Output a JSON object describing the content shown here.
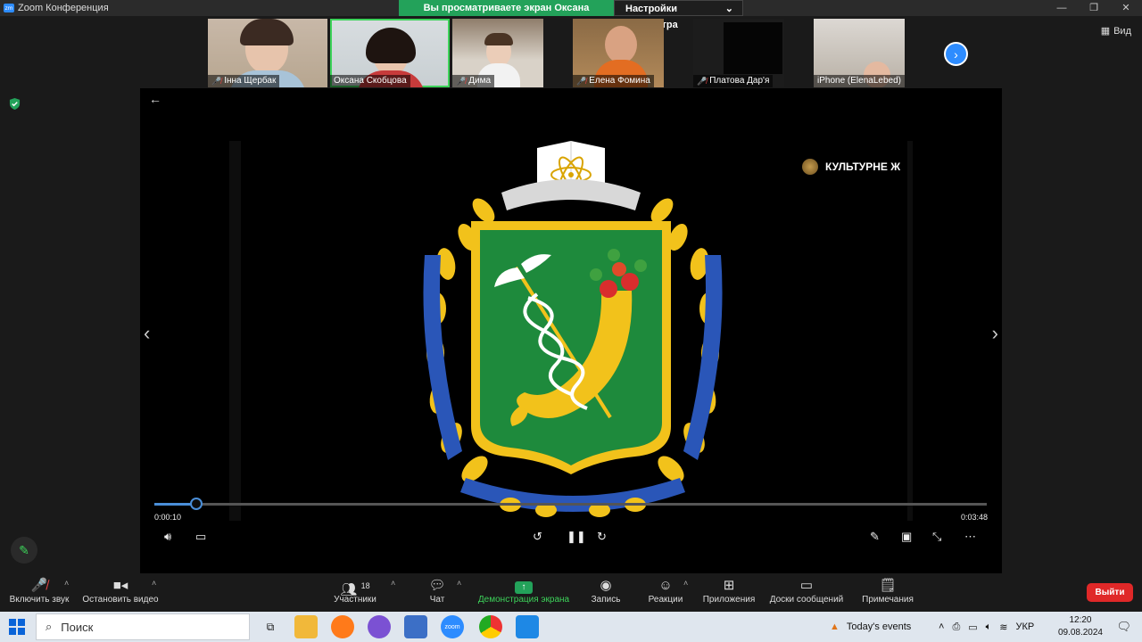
{
  "window": {
    "title": "Zoom Конференция",
    "viewing_banner": "Вы просматриваете экран Оксана Скобцова",
    "view_settings": "Настройки просмотра",
    "view_button": "Вид"
  },
  "participants": [
    {
      "name": "Інна Щербак",
      "muted": true
    },
    {
      "name": "Оксана Скобцова",
      "muted": false
    },
    {
      "name": "Дима",
      "muted": true
    },
    {
      "name": "Елена Фомина",
      "muted": true
    },
    {
      "name": "Платова Дар'я",
      "muted": true
    },
    {
      "name": "iPhone (ElenaLebed)",
      "muted": false
    }
  ],
  "shared_screen": {
    "channel": "КУЛЬТУРНЕ Ж",
    "time_current": "0:00:10",
    "time_total": "0:03:48",
    "progress": 0.05
  },
  "toolbar": {
    "unmute": "Включить звук",
    "start_video": "Остановить видео",
    "participants": "Участники",
    "participants_count": "18",
    "chat": "Чат",
    "share": "Демонстрация экрана",
    "record": "Запись",
    "reactions": "Реакции",
    "apps": "Приложения",
    "whiteboards": "Доски сообщений",
    "notes": "Примечания",
    "leave": "Выйти"
  },
  "taskbar": {
    "search": "Поиск",
    "weather": "Today's events",
    "language": "УКР",
    "time": "12:20",
    "date": "09.08.2024"
  },
  "colors": {
    "zoom_blue": "#2d8cff",
    "banner_green": "#23a25a",
    "leave_red": "#e02828",
    "crest_green": "#1e8a3c",
    "crest_gold": "#f2c21b",
    "crest_blue": "#2a56b8"
  }
}
